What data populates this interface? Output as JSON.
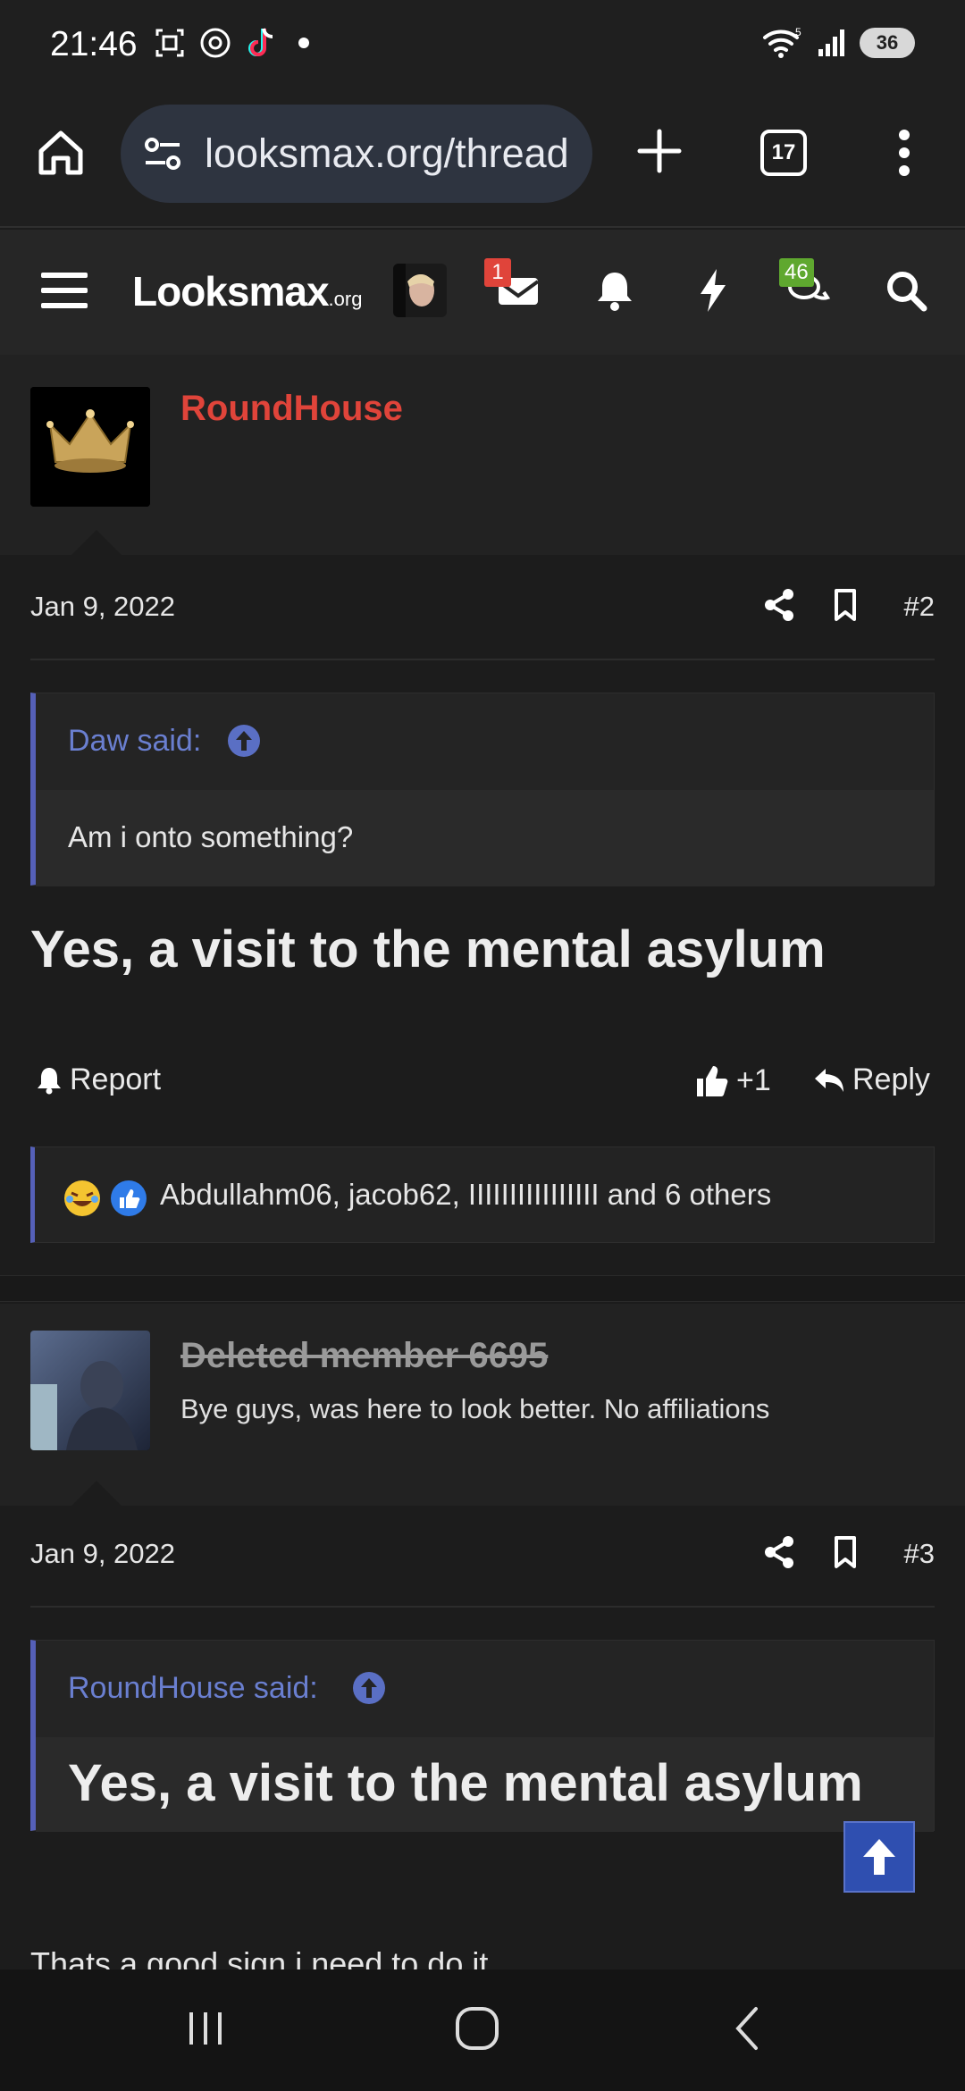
{
  "status_bar": {
    "time": "21:46",
    "battery": "36",
    "wifi_label": "5",
    "icons_left": [
      "screenshot-icon",
      "threads-icon",
      "tiktok-icon",
      "notification-dot"
    ],
    "icons_right": [
      "wifi-icon",
      "signal-icon",
      "battery-icon"
    ]
  },
  "browser": {
    "url": "looksmax.org/thread",
    "tab_count": "17"
  },
  "site_header": {
    "logo_main": "Looksmax",
    "logo_suffix": ".org",
    "inbox_badge": "1",
    "alerts_badge": "46",
    "colors": {
      "inbox_badge": "#e0443a",
      "alerts_badge": "#5fa82f"
    }
  },
  "posts": [
    {
      "username": "RoundHouse",
      "username_color": "#e0443a",
      "user_title": "",
      "date": "Jan 9, 2022",
      "post_number": "#2",
      "quote": {
        "author_label": "Daw said:",
        "text": "Am i onto something?"
      },
      "body": "Yes, a visit to the mental asylum",
      "actions": {
        "report": "Report",
        "like": "+1",
        "reply": "Reply"
      },
      "reactions_text": "Abdullahm06, jacob62, IIIIIIIIIIIIIIII and 6 others"
    },
    {
      "username": "Deleted member 6695",
      "username_color": "#9a9a9a",
      "user_title": "Bye guys, was here to look better. No affiliations",
      "date": "Jan 9, 2022",
      "post_number": "#3",
      "quote": {
        "author_label": "RoundHouse said:",
        "text": "Yes, a visit to the mental asylum"
      },
      "body": "Thats a good sign i need to do it"
    }
  ],
  "accent_color": "#5560b8"
}
